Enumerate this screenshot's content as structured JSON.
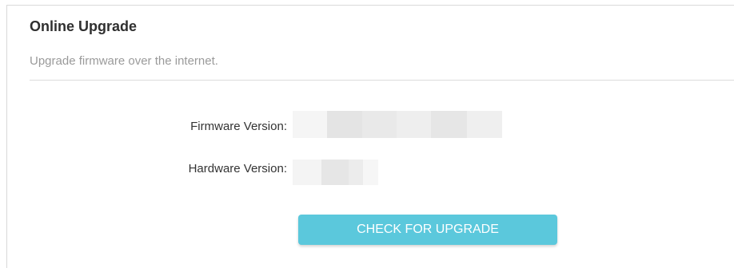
{
  "section": {
    "title": "Online Upgrade",
    "subtitle": "Upgrade firmware over the internet."
  },
  "fields": {
    "firmware_label": "Firmware Version:",
    "hardware_label": "Hardware Version:"
  },
  "actions": {
    "check_upgrade_label": "CHECK FOR UPGRADE"
  },
  "colors": {
    "button": "#5bc8dc",
    "title_text": "#2f2f2f",
    "subtitle_text": "#9a9a9a",
    "divider": "#dcdcdc"
  }
}
